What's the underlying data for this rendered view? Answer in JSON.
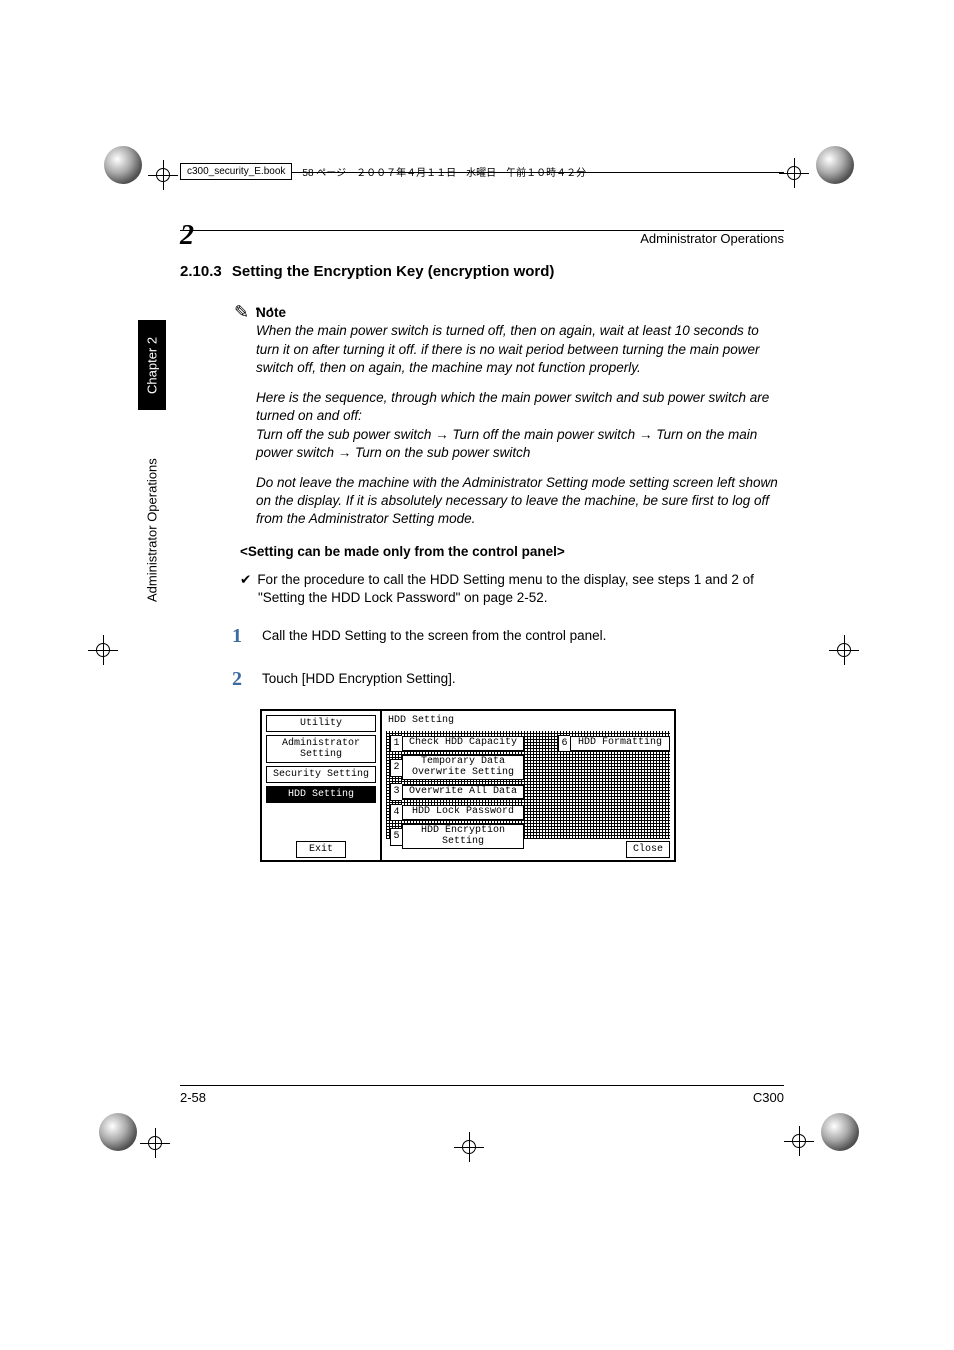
{
  "book_header": {
    "filename": "c300_security_E.book",
    "meta": "58 ページ　２００７年４月１１日　水曜日　午前１０時４２分"
  },
  "running_head": {
    "section": "Administrator Operations",
    "chapter_number": "2"
  },
  "side_tabs": {
    "chapter": "Chapter 2",
    "section": "Administrator Operations"
  },
  "section": {
    "number": "2.10.3",
    "title": "Setting the Encryption Key (encryption word)"
  },
  "note": {
    "label": "Note",
    "para1": "When the main power switch is turned off, then on again, wait at least 10 seconds to turn it on after turning it off. if there is no wait period between turning the main power switch off, then on again, the machine may not function properly.",
    "para2": "Here is the sequence, through which the main power switch and sub power switch are turned on and off:",
    "para3_pre": "Turn off the sub power switch ",
    "para3_mid": " Turn off the main power switch ",
    "para3_mid2": " Turn on the main power switch ",
    "para3_end": " Turn on the sub power switch",
    "para4": "Do not leave the machine with the Administrator Setting mode setting screen left shown on the display. If it is absolutely necessary to leave the machine, be sure first to log off from the Administrator Setting mode."
  },
  "sub_heading": "<Setting can be made only from the control panel>",
  "check_item": "For the procedure to call the HDD Setting menu to the display, see steps 1 and 2 of \"Setting the HDD Lock Password\" on page 2-52.",
  "steps": [
    {
      "n": "1",
      "t": "Call the HDD Setting to the screen from the control panel."
    },
    {
      "n": "2",
      "t": "Touch [HDD Encryption Setting]."
    }
  ],
  "panel": {
    "left_tabs": {
      "utility": "Utility",
      "admin": "Administrator\nSetting",
      "security": "Security Setting",
      "hdd": "HDD Setting"
    },
    "exit": "Exit",
    "title": "HDD Setting",
    "items_col1": [
      {
        "n": "1",
        "label": "Check HDD Capacity"
      },
      {
        "n": "2",
        "label": "Temporary Data\nOverwrite Setting"
      },
      {
        "n": "3",
        "label": "Overwrite All Data"
      },
      {
        "n": "4",
        "label": "HDD Lock Password"
      },
      {
        "n": "5",
        "label": "HDD Encryption\nSetting"
      }
    ],
    "items_col2": [
      {
        "n": "6",
        "label": "HDD Formatting"
      }
    ],
    "close": "Close"
  },
  "footer": {
    "page": "2-58",
    "model": "C300"
  }
}
